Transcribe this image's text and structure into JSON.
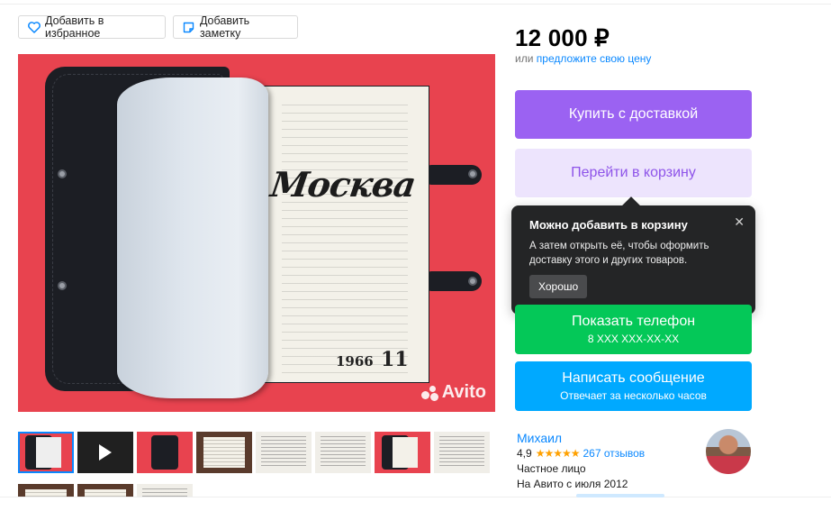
{
  "actions": {
    "favorite_label": "Добавить в избранное",
    "note_label": "Добавить заметку"
  },
  "photo": {
    "magazine_title": "Москва",
    "magazine_year": "1966",
    "magazine_issue": "11",
    "watermark": "Avito"
  },
  "thumbnails": [
    {
      "kind": "red",
      "selected": true
    },
    {
      "kind": "video",
      "selected": false
    },
    {
      "kind": "red",
      "selected": false
    },
    {
      "kind": "book",
      "selected": false
    },
    {
      "kind": "text",
      "selected": false
    },
    {
      "kind": "text",
      "selected": false
    },
    {
      "kind": "red",
      "selected": false
    },
    {
      "kind": "text",
      "selected": false
    }
  ],
  "price": {
    "amount": "12 000 ₽",
    "or_text": "или",
    "offer_link": "предложите свою цену"
  },
  "buttons": {
    "buy": "Купить с доставкой",
    "cart": "Перейти в корзину",
    "phone": "Показать телефон",
    "phone_sub": "8 XXX XXX-XX-XX",
    "message": "Написать сообщение",
    "message_sub": "Отвечает за несколько часов"
  },
  "tooltip": {
    "title": "Можно добавить в корзину",
    "body": "А затем открыть её, чтобы оформить доставку этого и других товаров.",
    "ok": "Хорошо",
    "close": "✕"
  },
  "seller": {
    "name": "Михаил",
    "rating": "4,9",
    "stars": "★★★★★",
    "reviews": "267 отзывов",
    "type": "Частное лицо",
    "since": "На Авито с июля 2012"
  },
  "colors": {
    "accent_link": "#0a88ff",
    "buy": "#9b62f2",
    "cart_bg": "#ede4fd",
    "phone": "#04c858",
    "message": "#00a9ff",
    "tooltip_bg": "#242526",
    "star": "#ffa100"
  },
  "icons": {
    "favorite": "heart-icon",
    "note": "note-icon",
    "play": "play-icon",
    "close": "close-icon"
  }
}
